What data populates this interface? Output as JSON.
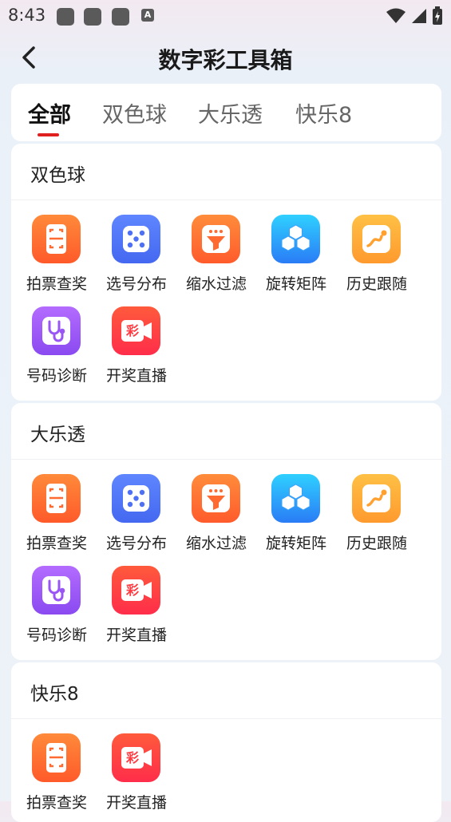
{
  "status_bar": {
    "time": "8:43",
    "notif_badge": "A"
  },
  "header": {
    "title": "数字彩工具箱"
  },
  "tabs": [
    {
      "label": "全部",
      "active": true
    },
    {
      "label": "双色球",
      "active": false
    },
    {
      "label": "大乐透",
      "active": false
    },
    {
      "label": "快乐8",
      "active": false
    }
  ],
  "sections": [
    {
      "title": "双色球",
      "tools": [
        {
          "label": "拍票查奖",
          "icon": "scan-ticket-icon"
        },
        {
          "label": "选号分布",
          "icon": "dice-icon"
        },
        {
          "label": "缩水过滤",
          "icon": "funnel-icon"
        },
        {
          "label": "旋转矩阵",
          "icon": "cubes-icon"
        },
        {
          "label": "历史跟随",
          "icon": "trend-line-icon"
        },
        {
          "label": "号码诊断",
          "icon": "stethoscope-icon"
        },
        {
          "label": "开奖直播",
          "icon": "video-camera-icon",
          "badge": "彩"
        }
      ]
    },
    {
      "title": "大乐透",
      "tools": [
        {
          "label": "拍票查奖",
          "icon": "scan-ticket-icon"
        },
        {
          "label": "选号分布",
          "icon": "dice-icon"
        },
        {
          "label": "缩水过滤",
          "icon": "funnel-icon"
        },
        {
          "label": "旋转矩阵",
          "icon": "cubes-icon"
        },
        {
          "label": "历史跟随",
          "icon": "trend-line-icon"
        },
        {
          "label": "号码诊断",
          "icon": "stethoscope-icon"
        },
        {
          "label": "开奖直播",
          "icon": "video-camera-icon",
          "badge": "彩"
        }
      ]
    },
    {
      "title": "快乐8",
      "tools": [
        {
          "label": "拍票查奖",
          "icon": "scan-ticket-icon"
        },
        {
          "label": "开奖直播",
          "icon": "video-camera-icon",
          "badge": "彩"
        }
      ]
    }
  ],
  "colors": {
    "accent": "#e0201f"
  }
}
